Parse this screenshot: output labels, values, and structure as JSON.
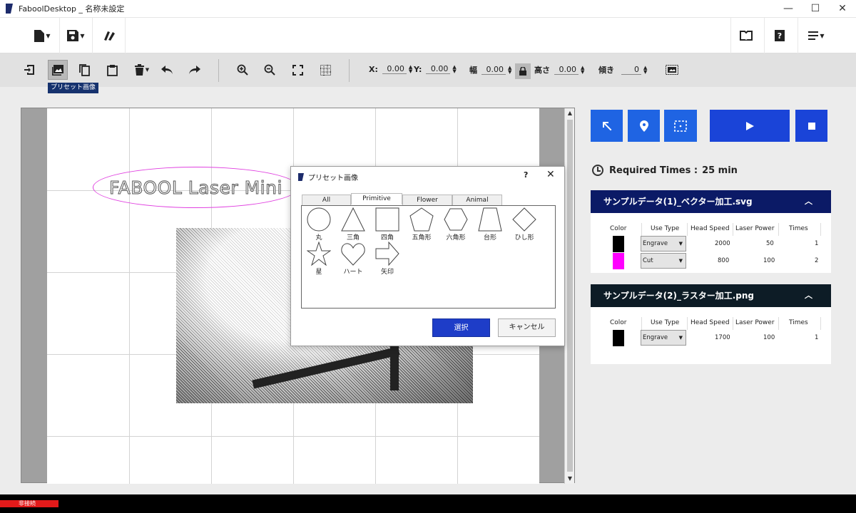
{
  "window": {
    "title": "FaboolDesktop _ 名称未設定",
    "minimize": "—",
    "maximize": "☐",
    "close": "✕"
  },
  "toolbar": {
    "tooltip": "プリセット画像",
    "x_label": "X:",
    "x_value": "0.00",
    "y_label": "Y:",
    "y_value": "0.00",
    "width_label": "幅",
    "width_value": "0.00",
    "height_label": "高さ",
    "height_value": "0.00",
    "angle_label": "傾き",
    "angle_value": "0"
  },
  "canvas": {
    "text_object": "FABOOL Laser Mini"
  },
  "dialog": {
    "title": "プリセット画像",
    "help": "?",
    "close": "✕",
    "tabs": [
      "All",
      "Primitive",
      "Flower",
      "Animal"
    ],
    "selected_tab": "Primitive",
    "shapes": [
      "丸",
      "三角",
      "四角",
      "五角形",
      "六角形",
      "台形",
      "ひし形",
      "星",
      "ハート",
      "矢印"
    ],
    "ok_label": "選択",
    "cancel_label": "キャンセル"
  },
  "panel": {
    "required_label": "Required Times :",
    "required_value": "25 min",
    "columns": [
      "Color",
      "Use Type",
      "Head Speed",
      "Laser Power",
      "Times"
    ],
    "layers": [
      {
        "name": "サンプルデータ(1)_ベクター加工.svg",
        "header_color": "#0b1a66",
        "rows": [
          {
            "color": "#000000",
            "use_type": "Engrave",
            "speed": "2000",
            "power": "50",
            "times": "1"
          },
          {
            "color": "#ff00ff",
            "use_type": "Cut",
            "speed": "800",
            "power": "100",
            "times": "2"
          }
        ]
      },
      {
        "name": "サンプルデータ(2)_ラスター加工.png",
        "header_color": "#0d1c26",
        "rows": [
          {
            "color": "#000000",
            "use_type": "Engrave",
            "speed": "1700",
            "power": "100",
            "times": "1"
          }
        ]
      }
    ]
  },
  "status": {
    "connection": "非接続"
  },
  "colors": {
    "accent": "#1f64e3",
    "run_button": "#1a44d8",
    "status_error": "#e21a1a"
  }
}
